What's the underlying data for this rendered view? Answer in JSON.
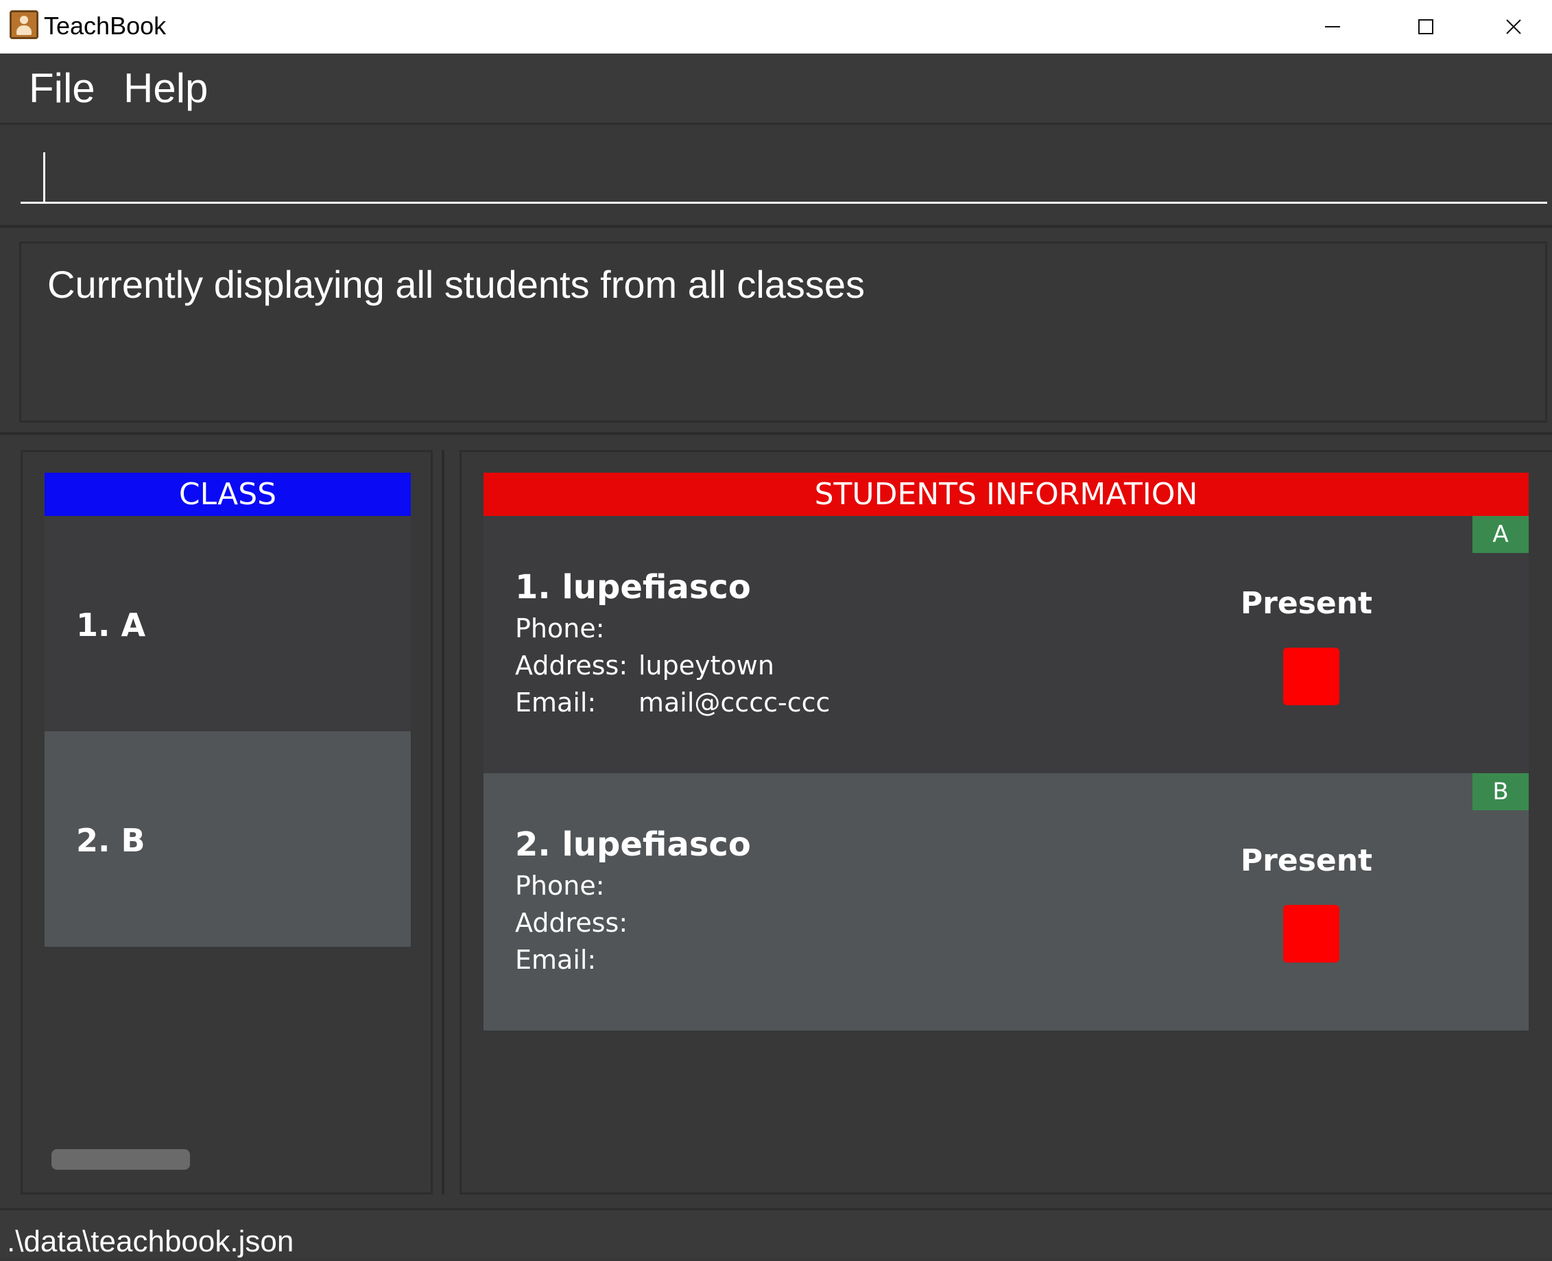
{
  "window": {
    "title": "TeachBook",
    "icons": {
      "app": "address-book-icon",
      "minimize": "minimize-icon",
      "maximize": "maximize-icon",
      "close": "close-icon"
    }
  },
  "menu": {
    "file": "File",
    "help": "Help"
  },
  "command": {
    "value": "",
    "placeholder": ""
  },
  "result": {
    "text": "Currently displaying all students from all classes"
  },
  "class_panel": {
    "header": "CLASS",
    "header_color": "#0a0af5",
    "items": [
      {
        "label": "1.  A"
      },
      {
        "label": "2.  B"
      }
    ]
  },
  "students_panel": {
    "header": "STUDENTS INFORMATION",
    "header_color": "#e60606",
    "students": [
      {
        "tag": "A",
        "name": "1.  lupefiasco",
        "phone_label": "Phone:",
        "phone": "",
        "address_label": "Address:",
        "address": "lupeytown",
        "email_label": "Email:",
        "email": "mail@cccc-ccc",
        "attendance_label": "Present",
        "attendance_color": "#ff0000"
      },
      {
        "tag": "B",
        "name": "2.  lupefiasco",
        "phone_label": "Phone:",
        "phone": "",
        "address_label": "Address:",
        "address": "",
        "email_label": "Email:",
        "email": "",
        "attendance_label": "Present",
        "attendance_color": "#ff0000"
      }
    ]
  },
  "status": {
    "path": ".\\data\\teachbook.json"
  }
}
